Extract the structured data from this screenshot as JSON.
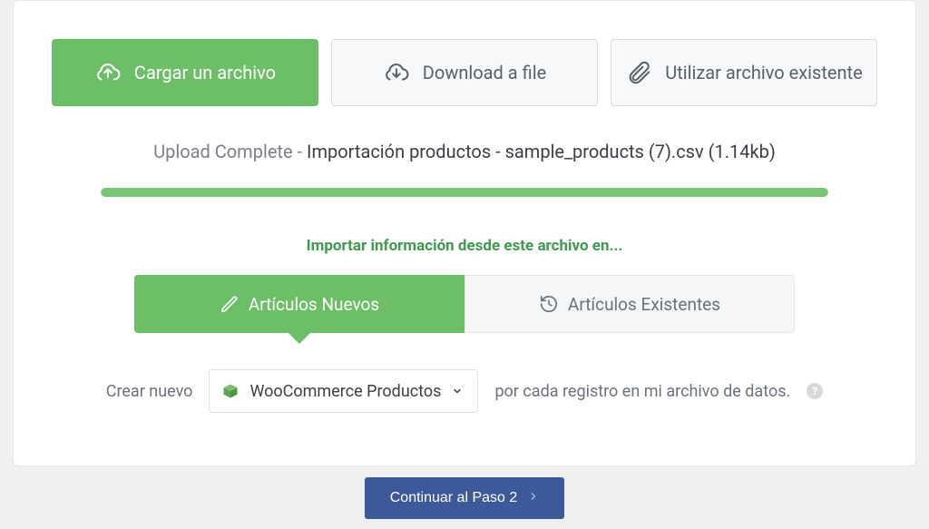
{
  "tabs": {
    "upload": {
      "label": "Cargar un archivo"
    },
    "download": {
      "label": "Download a file"
    },
    "existing": {
      "label": "Utilizar archivo existente"
    }
  },
  "upload_status": {
    "prefix": "Upload Complete",
    "sep": " - ",
    "filename": "Importación productos - sample_products (7).csv",
    "size": "(1.14kb)",
    "progress_percent": 100
  },
  "section_title": "Importar información desde este archivo en...",
  "import_mode": {
    "new": {
      "label": "Artículos Nuevos"
    },
    "existing": {
      "label": "Artículos Existentes"
    }
  },
  "create_row": {
    "before": "Crear nuevo",
    "select_value": "WooCommerce Productos",
    "after": "por cada registro en mi archivo de datos.",
    "help": "?"
  },
  "footer": {
    "continue_label": "Continuar al Paso 2"
  },
  "colors": {
    "accent_green": "#6dbf67",
    "footer_blue": "#3c5a99"
  }
}
